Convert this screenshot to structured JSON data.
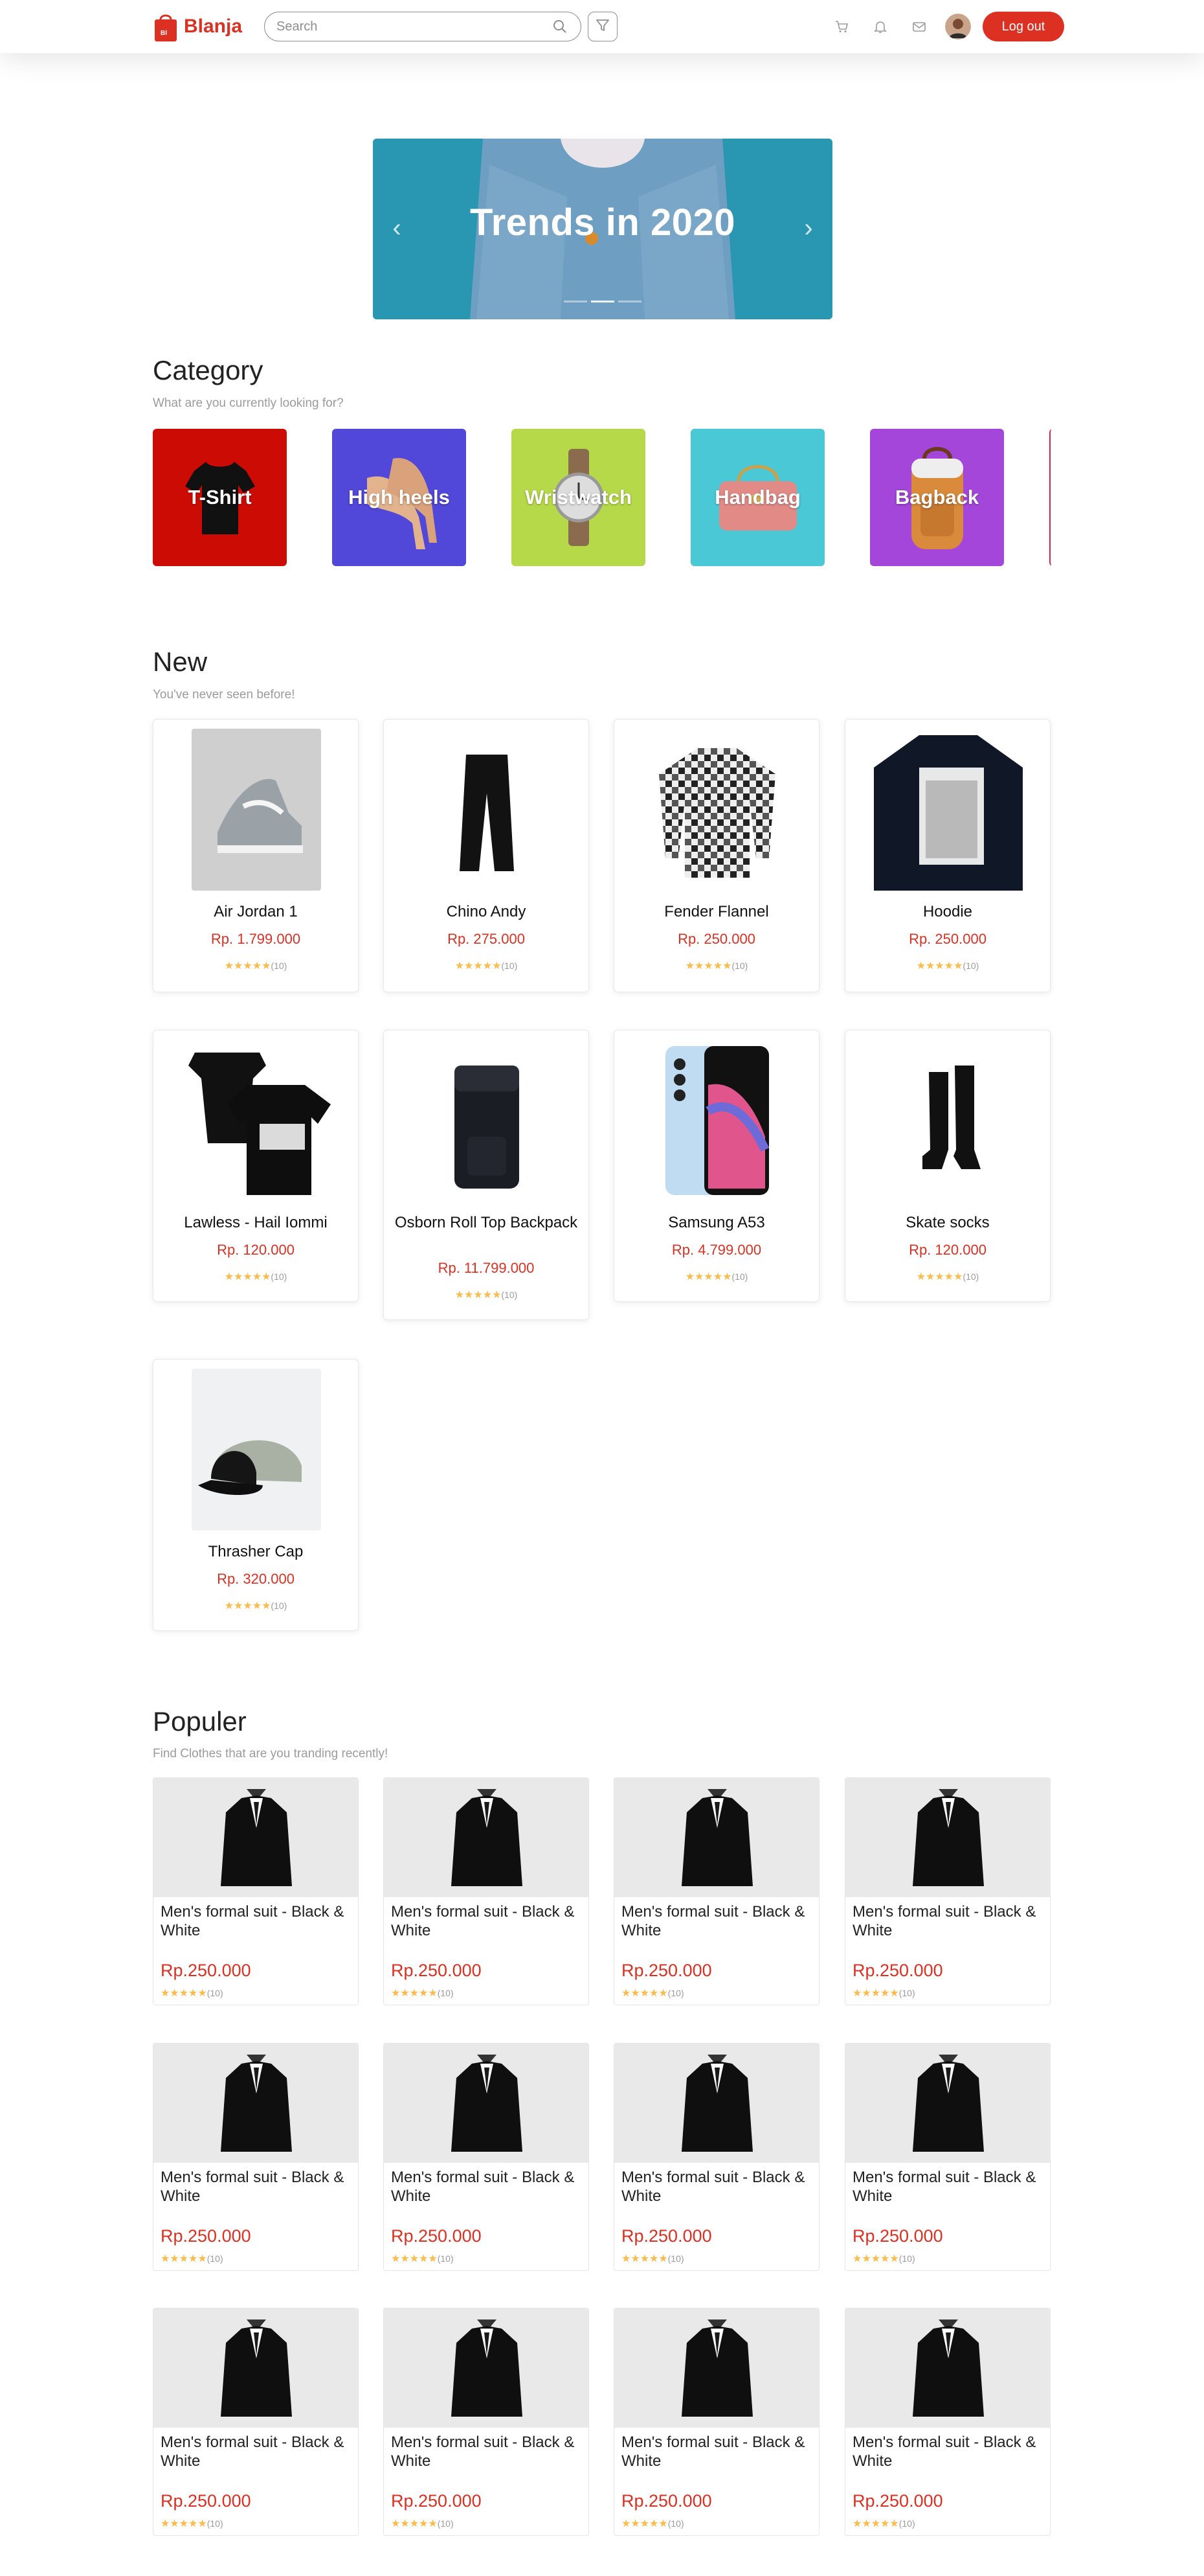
{
  "nav": {
    "brand": "Blanja",
    "search_placeholder": "Search",
    "logout_label": "Log out"
  },
  "banner": {
    "title": "Trends in 2020"
  },
  "category": {
    "title": "Category",
    "subtitle": "What are you currently looking for?",
    "items": [
      {
        "label": "T-Shirt",
        "color": "#CC0B04"
      },
      {
        "label": "High heels",
        "color": "#1C3391"
      },
      {
        "label": "Wristwatch",
        "color": "#F67B02"
      },
      {
        "label": "Handbag",
        "color": "#E31F51"
      },
      {
        "label": "Bagback",
        "color": "#57CD9E"
      }
    ]
  },
  "new": {
    "title": "New",
    "subtitle": "You've never seen before!",
    "products": [
      {
        "name": "Air Jordan 1",
        "price": "Rp. 1.799.000",
        "rating_count": "(10)"
      },
      {
        "name": "Chino Andy",
        "price": "Rp. 275.000",
        "rating_count": "(10)"
      },
      {
        "name": "Fender Flannel",
        "price": "Rp. 250.000",
        "rating_count": "(10)"
      },
      {
        "name": "Hoodie",
        "price": "Rp. 250.000",
        "rating_count": "(10)"
      },
      {
        "name": "Lawless - Hail Iommi",
        "price": "Rp. 120.000",
        "rating_count": "(10)"
      },
      {
        "name": "Osborn Roll Top Backpack",
        "price": "Rp. 11.799.000",
        "rating_count": "(10)"
      },
      {
        "name": "Samsung A53",
        "price": "Rp. 4.799.000",
        "rating_count": "(10)"
      },
      {
        "name": "Skate socks",
        "price": "Rp. 120.000",
        "rating_count": "(10)"
      },
      {
        "name": "Thrasher Cap",
        "price": "Rp. 320.000",
        "rating_count": "(10)"
      }
    ]
  },
  "popular": {
    "title": "Populer",
    "subtitle": "Find Clothes that are you tranding recently!",
    "products": [
      {
        "name": "Men's formal suit - Black & White",
        "price": "Rp.250.000",
        "rating_count": "(10)"
      },
      {
        "name": "Men's formal suit - Black & White",
        "price": "Rp.250.000",
        "rating_count": "(10)"
      },
      {
        "name": "Men's formal suit - Black & White",
        "price": "Rp.250.000",
        "rating_count": "(10)"
      },
      {
        "name": "Men's formal suit - Black & White",
        "price": "Rp.250.000",
        "rating_count": "(10)"
      },
      {
        "name": "Men's formal suit - Black & White",
        "price": "Rp.250.000",
        "rating_count": "(10)"
      },
      {
        "name": "Men's formal suit - Black & White",
        "price": "Rp.250.000",
        "rating_count": "(10)"
      },
      {
        "name": "Men's formal suit - Black & White",
        "price": "Rp.250.000",
        "rating_count": "(10)"
      },
      {
        "name": "Men's formal suit - Black & White",
        "price": "Rp.250.000",
        "rating_count": "(10)"
      },
      {
        "name": "Men's formal suit - Black & White",
        "price": "Rp.250.000",
        "rating_count": "(10)"
      },
      {
        "name": "Men's formal suit - Black & White",
        "price": "Rp.250.000",
        "rating_count": "(10)"
      },
      {
        "name": "Men's formal suit - Black & White",
        "price": "Rp.250.000",
        "rating_count": "(10)"
      },
      {
        "name": "Men's formal suit - Black & White",
        "price": "Rp.250.000",
        "rating_count": "(10)"
      }
    ]
  },
  "colors": {
    "brand": "#DB3022",
    "star": "#FFBA49",
    "muted": "#9B9B9B"
  },
  "icons": {
    "search": "search-icon",
    "filter": "filter-icon",
    "cart": "cart-icon",
    "bell": "bell-icon",
    "mail": "mail-icon"
  }
}
